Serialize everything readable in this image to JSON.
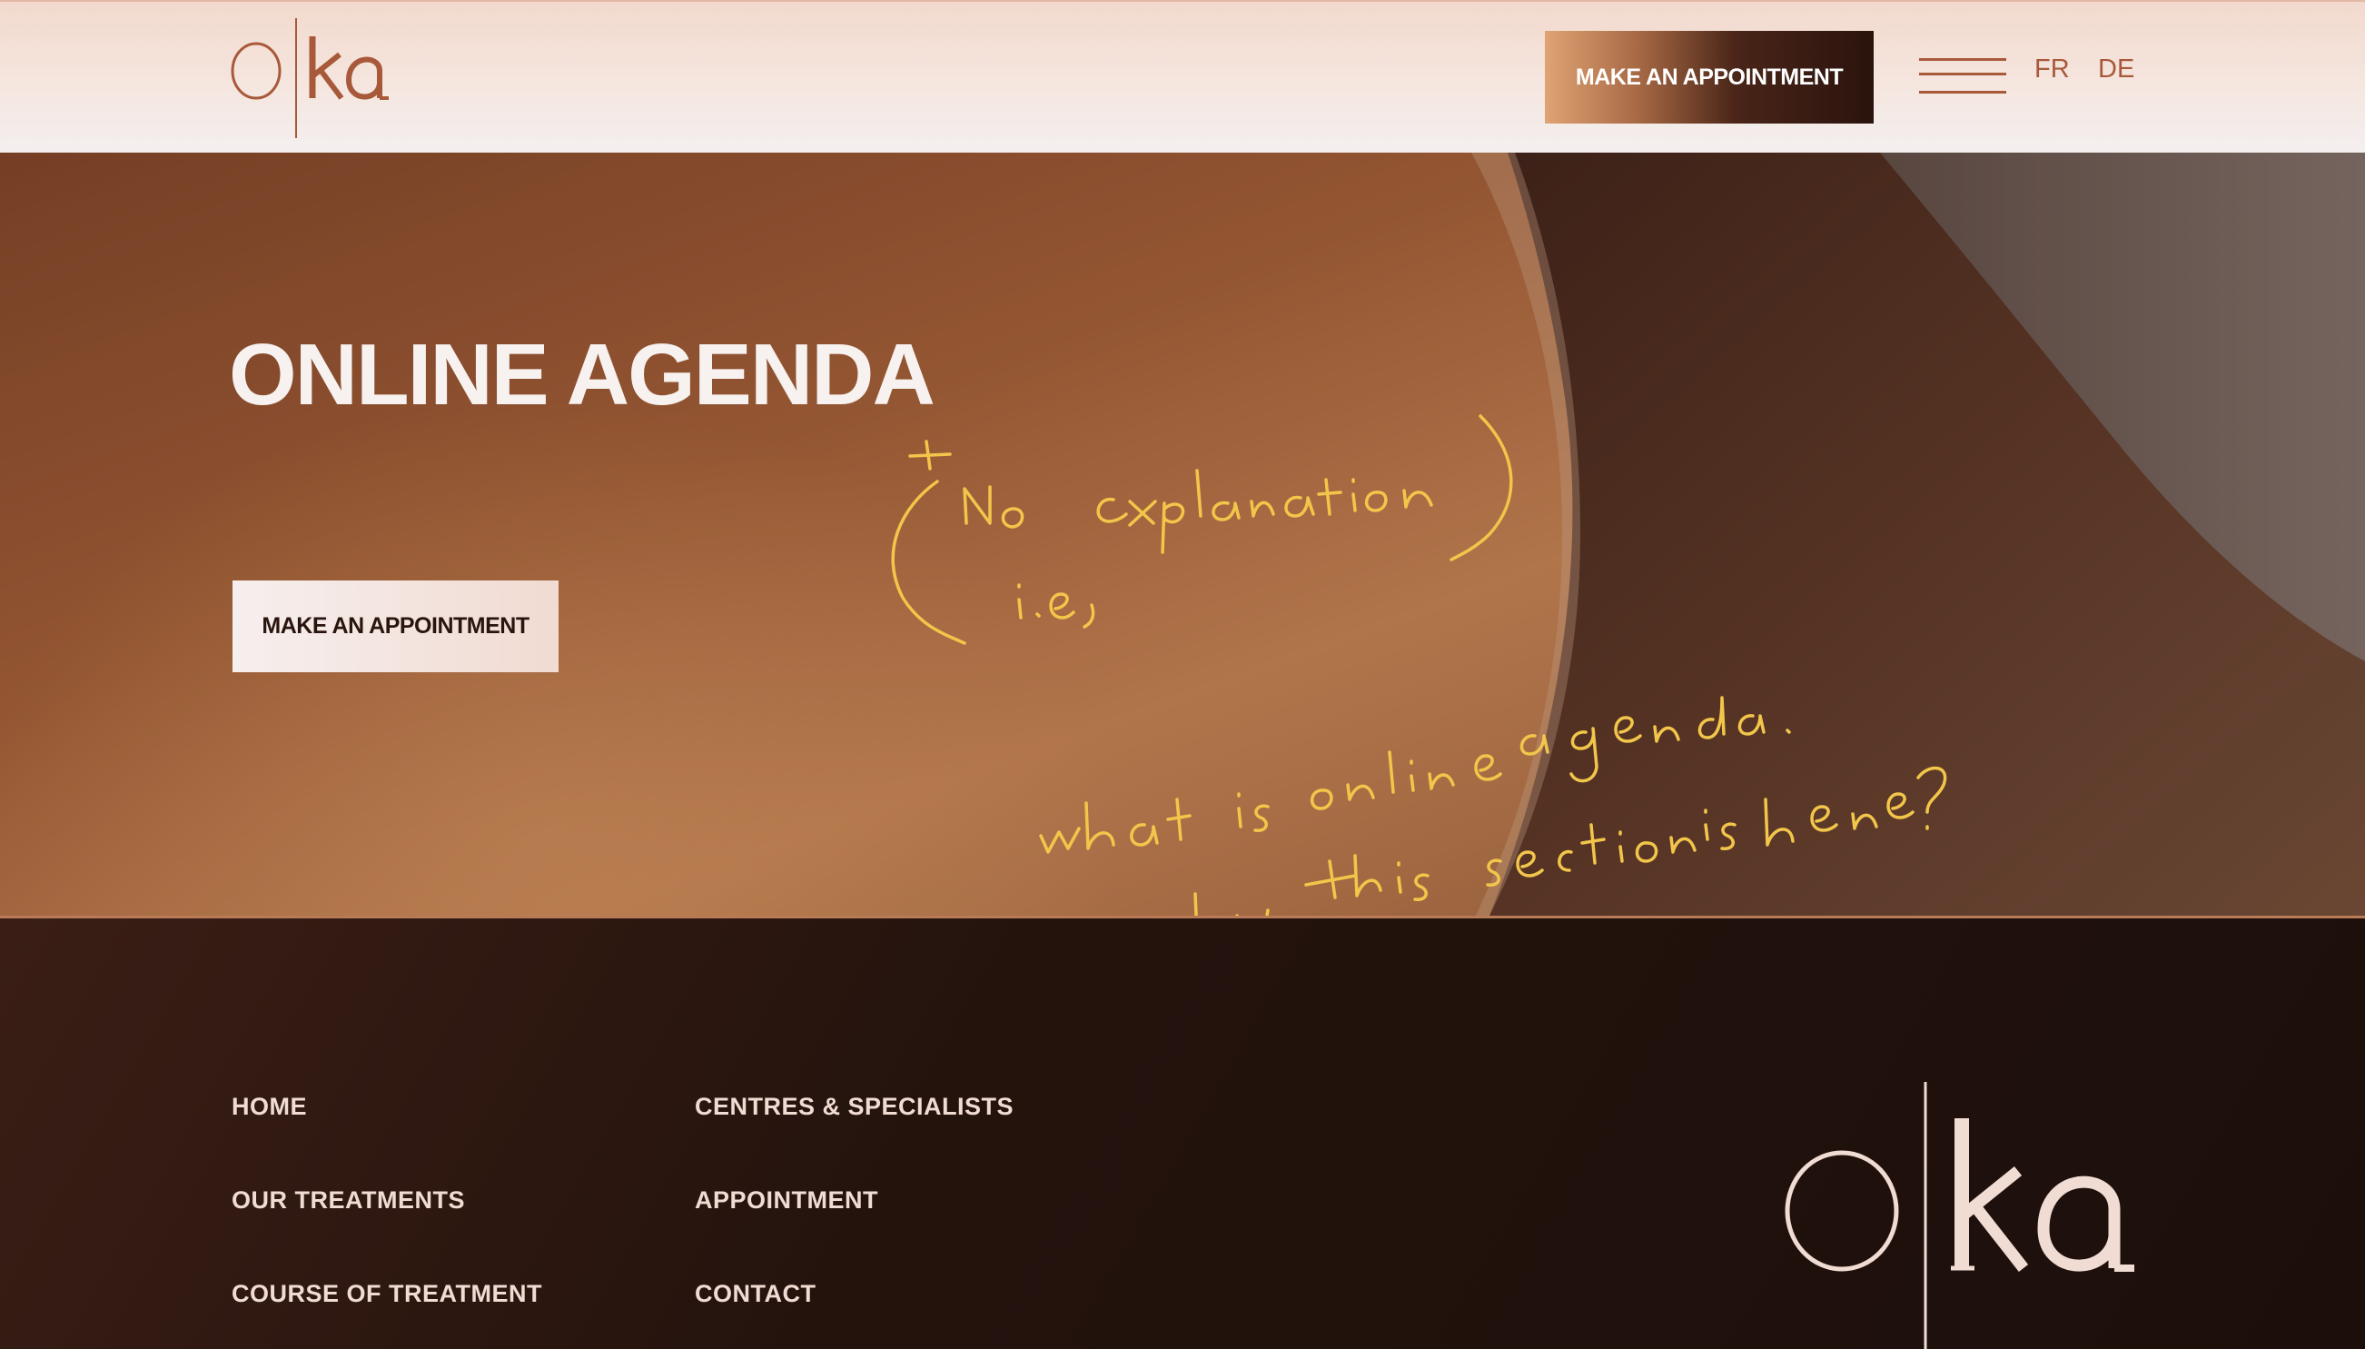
{
  "header": {
    "logo_text": "oka",
    "cta_label": "MAKE AN APPOINTMENT",
    "languages": [
      "FR",
      "DE"
    ]
  },
  "hero": {
    "title": "ONLINE AGENDA",
    "cta_label": "MAKE AN APPOINTMENT",
    "annotation_text": "+ No explanation i.e, what is online agenda. why this section is here?"
  },
  "footer": {
    "nav_col1": [
      "HOME",
      "OUR TREATMENTS",
      "COURSE OF TREATMENT"
    ],
    "nav_col2": [
      "CENTRES & SPECIALISTS",
      "APPOINTMENT",
      "CONTACT"
    ],
    "logo_text": "oka"
  },
  "colors": {
    "brand_copper": "#a8593a",
    "annotation_yellow": "#f2c64a",
    "footer_text": "#f1dcd3",
    "footer_bg": "#1c0f0b"
  }
}
